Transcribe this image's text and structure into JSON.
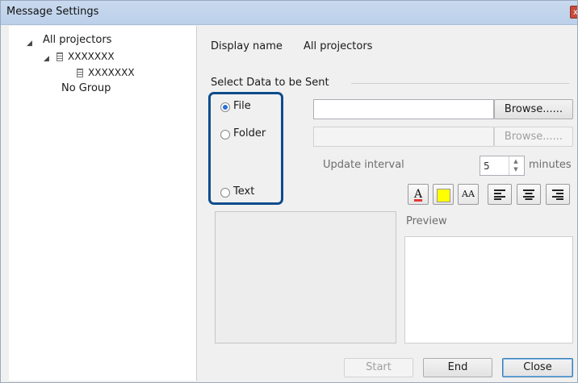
{
  "window": {
    "title": "Message Settings",
    "close_glyph": "x"
  },
  "tree": {
    "root": "All projectors",
    "group": "XXXXXXX",
    "projector": "XXXXXXX",
    "no_group": "No Group",
    "expand_glyph": "◢"
  },
  "settings": {
    "display_name_label": "Display name",
    "display_name_value": "All projectors",
    "select_data_label": "Select Data to be Sent",
    "options": {
      "file": "File",
      "folder": "Folder",
      "text": "Text"
    },
    "selected_option": "file",
    "browse_label": "Browse......",
    "update_interval_label": "Update interval",
    "update_interval_value": "5",
    "minutes_label": "minutes",
    "preview_label": "Preview"
  },
  "format_toolbar": {
    "font_color_glyph": "A",
    "highlight_color": "#ffff00",
    "font_size_glyph": "AA"
  },
  "buttons": {
    "start": "Start",
    "end": "End",
    "close": "Close"
  },
  "colors": {
    "accent_highlight": "#0e4c8c",
    "radio_selected": "#2b6fd6",
    "font_color_underline": "#e53935"
  }
}
